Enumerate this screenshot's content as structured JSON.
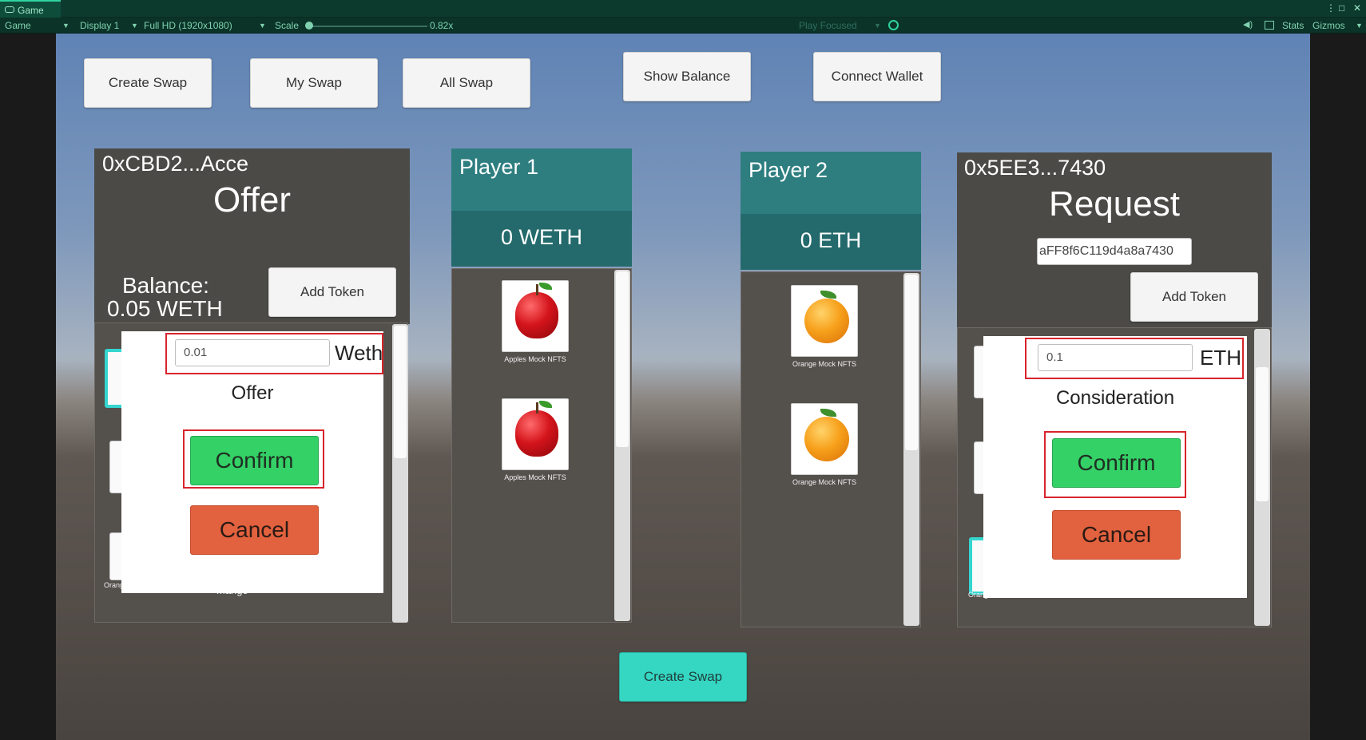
{
  "editor": {
    "tab_title": "Game",
    "game_dropdown": "Game",
    "display": "Display 1",
    "resolution": "Full HD (1920x1080)",
    "scale_label": "Scale",
    "scale_value": "0.82x",
    "play_mode": "Play Focused",
    "stats": "Stats",
    "gizmos": "Gizmos"
  },
  "nav": {
    "create_swap": "Create Swap",
    "my_swap": "My Swap",
    "all_swap": "All Swap",
    "show_balance": "Show Balance",
    "connect_wallet": "Connect Wallet"
  },
  "offer_panel": {
    "address": "0xCBD2...Acce",
    "title": "Offer",
    "balance_label": "Balance:",
    "balance_value": "0.05 WETH",
    "add_token": "Add Token",
    "items": [
      "Orange Mock NFTS",
      "Mango"
    ],
    "modal": {
      "amount": "0.01",
      "currency": "Weth",
      "label": "Offer",
      "confirm": "Confirm",
      "cancel": "Cancel"
    }
  },
  "player1": {
    "title": "Player 1",
    "balance": "0 WETH",
    "items": [
      "Apples Mock NFTS",
      "Apples Mock NFTS"
    ]
  },
  "player2": {
    "title": "Player 2",
    "balance": "0 ETH",
    "items": [
      "Orange Mock NFTS",
      "Orange Mock NFTS"
    ]
  },
  "request_panel": {
    "address": "0x5EE3...7430",
    "title": "Request",
    "address_field": "aFF8f6C119d4a8a7430",
    "add_token": "Add Token",
    "items": [
      "Orange Mock NFTS"
    ],
    "modal": {
      "amount": "0.1",
      "currency": "ETH",
      "label": "Consideration",
      "confirm": "Confirm",
      "cancel": "Cancel"
    }
  },
  "footer": {
    "create_swap": "Create Swap"
  },
  "colors": {
    "confirm": "#34d166",
    "cancel": "#e2613e",
    "teal": "#2e7e80",
    "create_swap_bottom": "#35d6c2",
    "highlight": "#d8242c"
  }
}
